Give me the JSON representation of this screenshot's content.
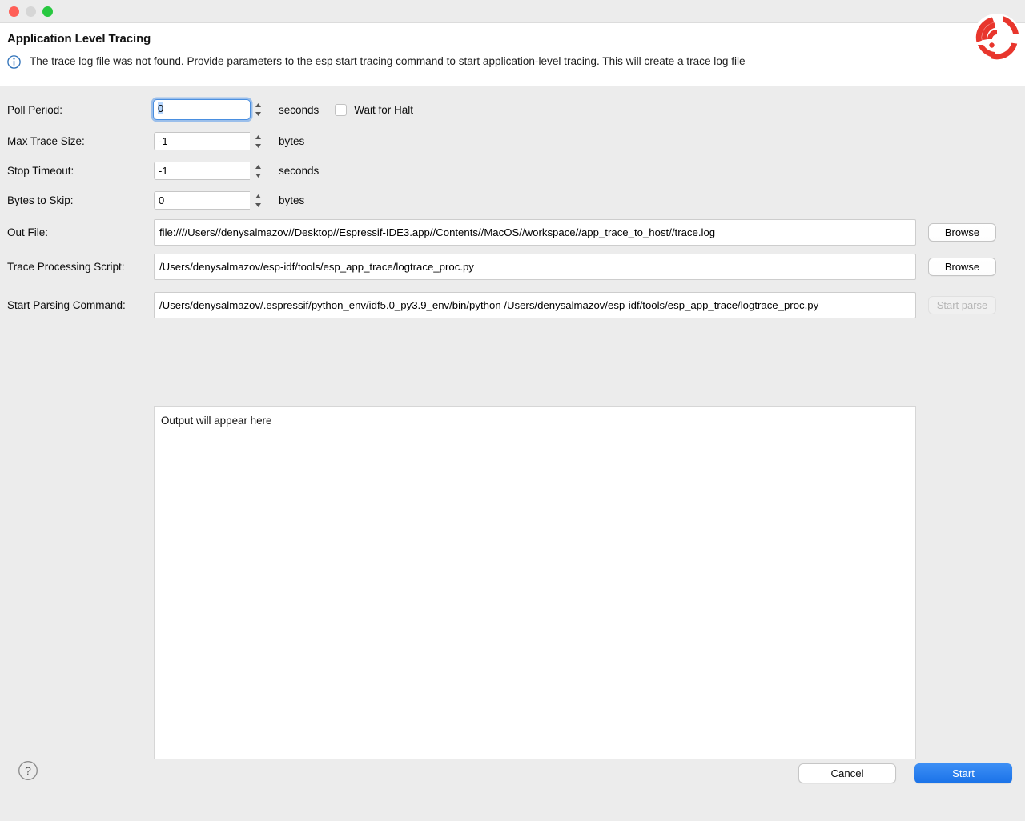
{
  "window": {
    "traffic_lights": [
      "close",
      "minimize",
      "zoom"
    ]
  },
  "header": {
    "title": "Application Level Tracing",
    "message": "The trace log file was not found. Provide parameters to the esp start tracing command to start application-level tracing. This will create a trace log file",
    "info_icon": "info-circle-icon",
    "logo": "espressif-logo"
  },
  "form": {
    "poll_period": {
      "label": "Poll Period:",
      "value": "0",
      "unit": "seconds",
      "focused": true
    },
    "max_trace_size": {
      "label": "Max Trace Size:",
      "value": "-1",
      "unit": "bytes"
    },
    "stop_timeout": {
      "label": "Stop Timeout:",
      "value": "-1",
      "unit": "seconds"
    },
    "bytes_to_skip": {
      "label": "Bytes to Skip:",
      "value": "0",
      "unit": "bytes"
    },
    "wait_for_halt": {
      "label": "Wait for Halt",
      "checked": false
    },
    "out_file": {
      "label": "Out File:",
      "value": "file:////Users//denysalmazov//Desktop//Espressif-IDE3.app//Contents//MacOS//workspace//app_trace_to_host//trace.log",
      "browse_label": "Browse"
    },
    "trace_processing_script": {
      "label": "Trace Processing Script:",
      "value": "/Users/denysalmazov/esp-idf/tools/esp_app_trace/logtrace_proc.py",
      "browse_label": "Browse"
    },
    "start_parsing_command": {
      "label": "Start Parsing Command:",
      "value": "/Users/denysalmazov/.espressif/python_env/idf5.0_py3.9_env/bin/python /Users/denysalmazov/esp-idf/tools/esp_app_trace/logtrace_proc.py",
      "start_parse_label": "Start parse",
      "start_parse_disabled": true
    }
  },
  "output": {
    "text": "Output will appear here"
  },
  "footer": {
    "help_label": "?",
    "cancel_label": "Cancel",
    "start_label": "Start"
  },
  "colors": {
    "accent_blue": "#1a72e8",
    "focus_ring": "#5a9beb",
    "espressif_red": "#e8362d",
    "info_blue": "#2b6fb8",
    "body_bg": "#ececec",
    "header_bg": "#ffffff"
  }
}
